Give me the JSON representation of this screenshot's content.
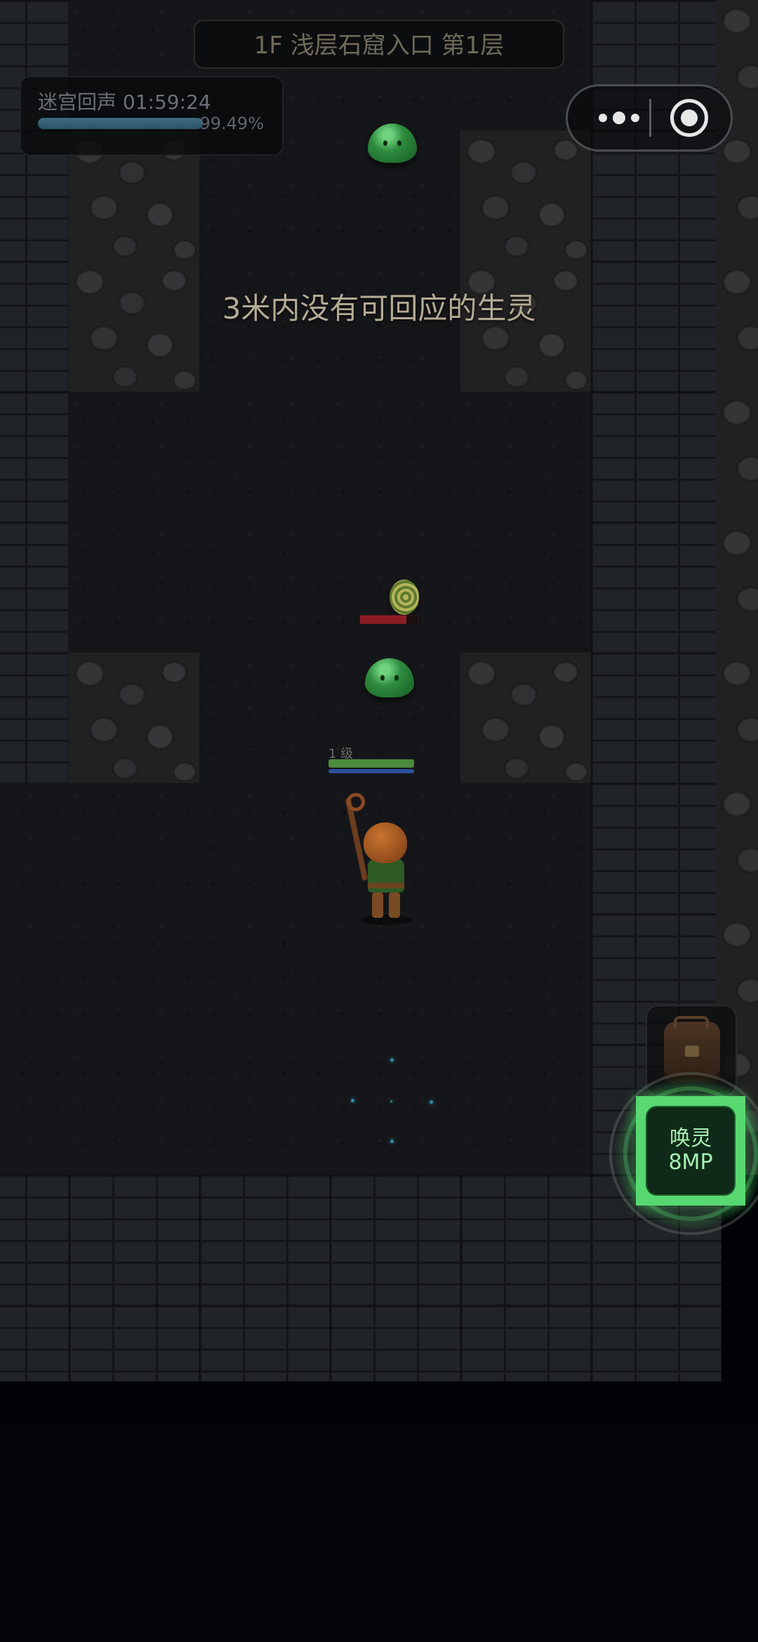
{
  "hud": {
    "floor_title": "1F 浅层石窟入口 第1层",
    "echo_label": "迷宫回声 01:59:24",
    "echo_percent": "99.49%",
    "echo_fraction": 0.9949
  },
  "toast": "3米内没有可回应的生灵",
  "enemy": {
    "hp_fraction": 0.8
  },
  "player": {
    "level_label": "1 级",
    "hp_fraction": 1.0,
    "mp_fraction": 1.0
  },
  "actions": {
    "bag_icon": "backpack-icon",
    "summon_label": "唤灵",
    "summon_cost": "8MP"
  },
  "colors": {
    "summon_accent": "#58d870",
    "echo_bar": "#3d6c84",
    "enemy_hp": "#8c1d24",
    "player_hp": "#4c8a3c",
    "player_mp": "#2e4e9c"
  }
}
